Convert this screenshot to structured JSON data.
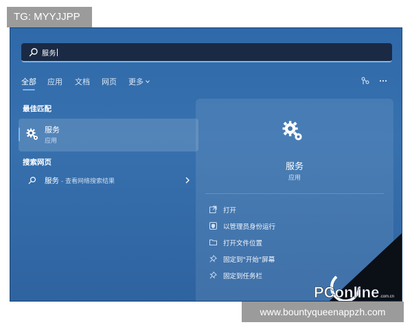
{
  "overlay": {
    "tg_badge": "TG: MYYJJPP",
    "url_badge": "www.bountyqueenappzh.com"
  },
  "search": {
    "query": "服务",
    "icon": "search-icon"
  },
  "tabs": [
    {
      "label": "全部",
      "active": true
    },
    {
      "label": "应用",
      "active": false
    },
    {
      "label": "文档",
      "active": false
    },
    {
      "label": "网页",
      "active": false
    },
    {
      "label": "更多",
      "active": false,
      "dropdown": true
    }
  ],
  "toolbar_icons": [
    "share-icon",
    "more-icon"
  ],
  "best_match": {
    "section_label": "最佳匹配",
    "title": "服务",
    "subtitle": "应用",
    "icon": "gear-icon"
  },
  "web_search": {
    "section_label": "搜索网页",
    "term": "服务",
    "suffix": " - 查看网络搜索结果",
    "icon": "search-icon"
  },
  "detail": {
    "title": "服务",
    "subtitle": "应用",
    "icon": "gear-icon",
    "actions": [
      {
        "label": "打开",
        "icon": "open-icon"
      },
      {
        "label": "以管理员身份运行",
        "icon": "admin-shield-icon"
      },
      {
        "label": "打开文件位置",
        "icon": "folder-icon"
      },
      {
        "label": "固定到\"开始\"屏幕",
        "icon": "pin-icon"
      },
      {
        "label": "固定到任务栏",
        "icon": "pin-icon"
      }
    ]
  },
  "watermark": {
    "brand": "PConline",
    "domain": ".com.cn",
    "chinese": "太平洋电脑网"
  },
  "colors": {
    "screen_bg": "#3771ae",
    "accent": "#7fb7f2",
    "search_bg": "#1b2a44"
  }
}
